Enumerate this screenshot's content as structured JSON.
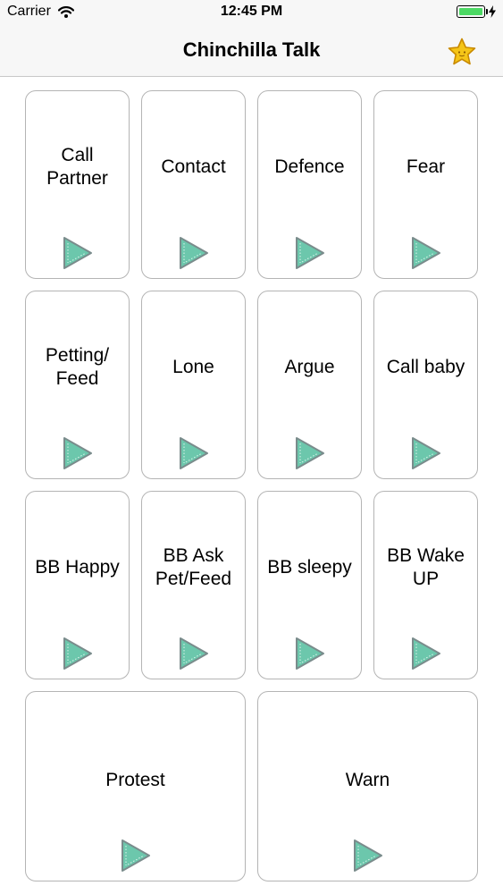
{
  "status_bar": {
    "carrier": "Carrier",
    "time": "12:45 PM",
    "battery_level": 1.0,
    "battery_color": "#4cd964",
    "icons": [
      "wifi-icon",
      "battery-icon",
      "charging-icon"
    ]
  },
  "nav": {
    "title": "Chinchilla Talk",
    "favorites_icon": "star-icon",
    "star_color": "#f5c518"
  },
  "tiles": [
    {
      "label": "Call\nPartner"
    },
    {
      "label": "Contact"
    },
    {
      "label": "Defence"
    },
    {
      "label": "Fear"
    },
    {
      "label": "Petting/\nFeed"
    },
    {
      "label": "Lone"
    },
    {
      "label": "Argue"
    },
    {
      "label": "Call baby"
    },
    {
      "label": "BB Happy"
    },
    {
      "label": "BB Ask\nPet/Feed"
    },
    {
      "label": "BB sleepy"
    },
    {
      "label": "BB Wake\nUP"
    },
    {
      "label": "Protest"
    },
    {
      "label": "Warn"
    }
  ],
  "play_icon": {
    "name": "play-icon",
    "fill": "#6cc7ac",
    "stroke": "#7a8c8c"
  }
}
